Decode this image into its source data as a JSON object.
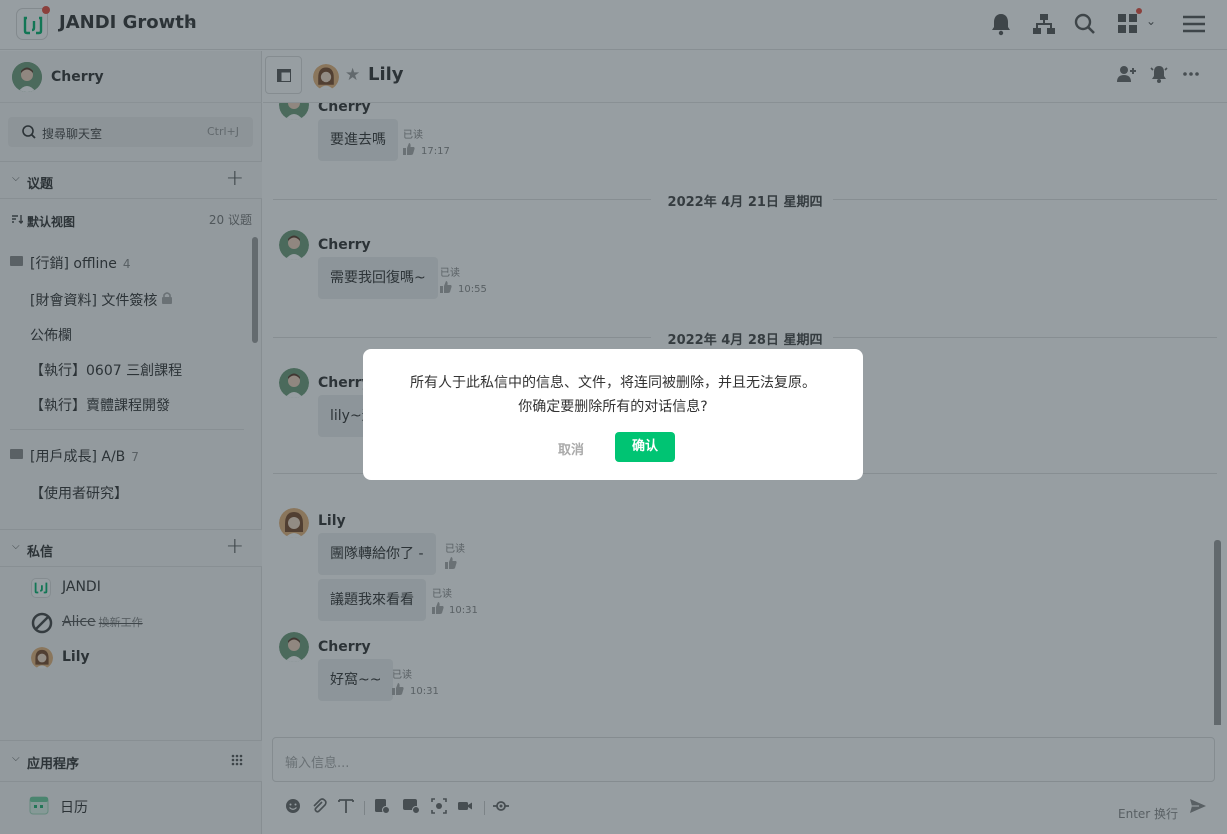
{
  "app": {
    "team_name": "JANDI Growth"
  },
  "sidebar": {
    "me": {
      "name": "Cherry"
    },
    "search": {
      "placeholder": "搜尋聊天室",
      "shortcut": "Ctrl+J"
    },
    "topics": {
      "title": "议题",
      "view_label": "默认视图",
      "count_label": "20 议题",
      "folders": [
        {
          "name": "[行銷] offline",
          "count": "4",
          "items": [
            "[財會資料] 文件簽核",
            "公佈欄",
            "【執行】0607 三創課程",
            "【執行】賣體課程開發"
          ]
        },
        {
          "name": "[用戶成長] A/B",
          "count": "7",
          "items": [
            "【使用者研究】"
          ]
        }
      ]
    },
    "dms": {
      "title": "私信",
      "items": [
        {
          "name": "JANDI"
        },
        {
          "name": "Alice",
          "status": "換新工作"
        },
        {
          "name": "Lily"
        }
      ]
    },
    "apps": {
      "title": "应用程序",
      "items": [
        {
          "name": "日历"
        }
      ]
    }
  },
  "chat": {
    "title": "Lily",
    "messages": [
      {
        "sender": "Cherry",
        "text": "要進去嗎",
        "read": "已读",
        "time": "17:17"
      },
      {
        "date": "2022年 4月 21日 星期四"
      },
      {
        "sender": "Cherry",
        "text": "需要我回復嗎~",
        "read": "已读",
        "time": "10:55"
      },
      {
        "date": "2022年 4月 28日 星期四"
      },
      {
        "sender": "Cherry",
        "text": "lily~這"
      },
      {
        "sender": "Lily",
        "text": "團隊轉給你了 -",
        "read": "已读"
      },
      {
        "text": "議題我來看看",
        "read": "已读",
        "time": "10:31"
      },
      {
        "sender": "Cherry",
        "text": "好窩~~",
        "read": "已读",
        "time": "10:31"
      }
    ],
    "composer": {
      "placeholder": "输入信息...",
      "enter_hint": "Enter 换行"
    }
  },
  "dialog": {
    "line1": "所有人于此私信中的信息、文件，将连同被删除，并且无法复原。",
    "line2": "你确定要删除所有的对话信息?",
    "cancel_label": "取消",
    "confirm_label": "确认"
  },
  "colors": {
    "accent": "#00c473",
    "badge": "#e84c3d",
    "overlay": "#26343c"
  }
}
